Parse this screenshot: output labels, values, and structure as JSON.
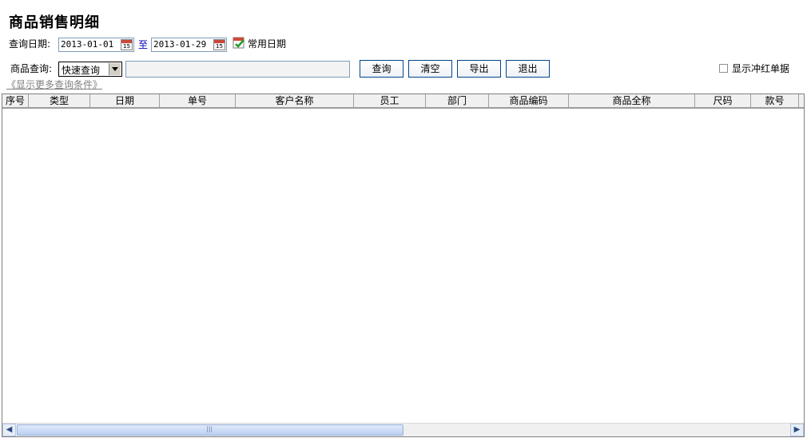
{
  "page_title": "商品销售明细",
  "query_date": {
    "label": "查询日期:",
    "start": "2013-01-01",
    "to_label": "至",
    "end": "2013-01-29",
    "common_date_label": "常用日期"
  },
  "product_query": {
    "label": "商品查询:",
    "mode_selected": "快速查询",
    "input_value": "",
    "input_placeholder": ""
  },
  "buttons": {
    "query": "查询",
    "clear": "清空",
    "export": "导出",
    "exit": "退出"
  },
  "show_reversal_label": "显示冲红单据",
  "show_reversal_checked": false,
  "more_conditions_link": "《显示更多查询条件》",
  "table": {
    "columns": [
      "序号",
      "类型",
      "日期",
      "单号",
      "客户名称",
      "员工",
      "部门",
      "商品编码",
      "商品全称",
      "尺码",
      "款号"
    ],
    "rows": []
  },
  "calendar_icon_text": "15",
  "icons": {
    "calendar": "calendar-icon",
    "common_date": "calendar-check-icon",
    "scroll_left": "chevron-left-icon",
    "scroll_right": "chevron-right-icon"
  }
}
